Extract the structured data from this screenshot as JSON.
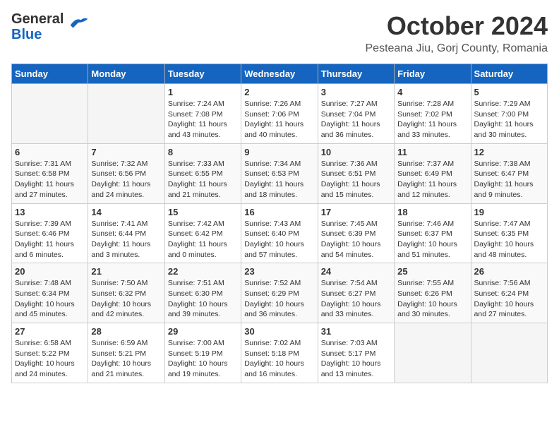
{
  "header": {
    "logo_general": "General",
    "logo_blue": "Blue",
    "month_title": "October 2024",
    "location": "Pesteana Jiu, Gorj County, Romania"
  },
  "days_of_week": [
    "Sunday",
    "Monday",
    "Tuesday",
    "Wednesday",
    "Thursday",
    "Friday",
    "Saturday"
  ],
  "weeks": [
    [
      {
        "day": "",
        "sunrise": "",
        "sunset": "",
        "daylight": ""
      },
      {
        "day": "",
        "sunrise": "",
        "sunset": "",
        "daylight": ""
      },
      {
        "day": "1",
        "sunrise": "Sunrise: 7:24 AM",
        "sunset": "Sunset: 7:08 PM",
        "daylight": "Daylight: 11 hours and 43 minutes."
      },
      {
        "day": "2",
        "sunrise": "Sunrise: 7:26 AM",
        "sunset": "Sunset: 7:06 PM",
        "daylight": "Daylight: 11 hours and 40 minutes."
      },
      {
        "day": "3",
        "sunrise": "Sunrise: 7:27 AM",
        "sunset": "Sunset: 7:04 PM",
        "daylight": "Daylight: 11 hours and 36 minutes."
      },
      {
        "day": "4",
        "sunrise": "Sunrise: 7:28 AM",
        "sunset": "Sunset: 7:02 PM",
        "daylight": "Daylight: 11 hours and 33 minutes."
      },
      {
        "day": "5",
        "sunrise": "Sunrise: 7:29 AM",
        "sunset": "Sunset: 7:00 PM",
        "daylight": "Daylight: 11 hours and 30 minutes."
      }
    ],
    [
      {
        "day": "6",
        "sunrise": "Sunrise: 7:31 AM",
        "sunset": "Sunset: 6:58 PM",
        "daylight": "Daylight: 11 hours and 27 minutes."
      },
      {
        "day": "7",
        "sunrise": "Sunrise: 7:32 AM",
        "sunset": "Sunset: 6:56 PM",
        "daylight": "Daylight: 11 hours and 24 minutes."
      },
      {
        "day": "8",
        "sunrise": "Sunrise: 7:33 AM",
        "sunset": "Sunset: 6:55 PM",
        "daylight": "Daylight: 11 hours and 21 minutes."
      },
      {
        "day": "9",
        "sunrise": "Sunrise: 7:34 AM",
        "sunset": "Sunset: 6:53 PM",
        "daylight": "Daylight: 11 hours and 18 minutes."
      },
      {
        "day": "10",
        "sunrise": "Sunrise: 7:36 AM",
        "sunset": "Sunset: 6:51 PM",
        "daylight": "Daylight: 11 hours and 15 minutes."
      },
      {
        "day": "11",
        "sunrise": "Sunrise: 7:37 AM",
        "sunset": "Sunset: 6:49 PM",
        "daylight": "Daylight: 11 hours and 12 minutes."
      },
      {
        "day": "12",
        "sunrise": "Sunrise: 7:38 AM",
        "sunset": "Sunset: 6:47 PM",
        "daylight": "Daylight: 11 hours and 9 minutes."
      }
    ],
    [
      {
        "day": "13",
        "sunrise": "Sunrise: 7:39 AM",
        "sunset": "Sunset: 6:46 PM",
        "daylight": "Daylight: 11 hours and 6 minutes."
      },
      {
        "day": "14",
        "sunrise": "Sunrise: 7:41 AM",
        "sunset": "Sunset: 6:44 PM",
        "daylight": "Daylight: 11 hours and 3 minutes."
      },
      {
        "day": "15",
        "sunrise": "Sunrise: 7:42 AM",
        "sunset": "Sunset: 6:42 PM",
        "daylight": "Daylight: 11 hours and 0 minutes."
      },
      {
        "day": "16",
        "sunrise": "Sunrise: 7:43 AM",
        "sunset": "Sunset: 6:40 PM",
        "daylight": "Daylight: 10 hours and 57 minutes."
      },
      {
        "day": "17",
        "sunrise": "Sunrise: 7:45 AM",
        "sunset": "Sunset: 6:39 PM",
        "daylight": "Daylight: 10 hours and 54 minutes."
      },
      {
        "day": "18",
        "sunrise": "Sunrise: 7:46 AM",
        "sunset": "Sunset: 6:37 PM",
        "daylight": "Daylight: 10 hours and 51 minutes."
      },
      {
        "day": "19",
        "sunrise": "Sunrise: 7:47 AM",
        "sunset": "Sunset: 6:35 PM",
        "daylight": "Daylight: 10 hours and 48 minutes."
      }
    ],
    [
      {
        "day": "20",
        "sunrise": "Sunrise: 7:48 AM",
        "sunset": "Sunset: 6:34 PM",
        "daylight": "Daylight: 10 hours and 45 minutes."
      },
      {
        "day": "21",
        "sunrise": "Sunrise: 7:50 AM",
        "sunset": "Sunset: 6:32 PM",
        "daylight": "Daylight: 10 hours and 42 minutes."
      },
      {
        "day": "22",
        "sunrise": "Sunrise: 7:51 AM",
        "sunset": "Sunset: 6:30 PM",
        "daylight": "Daylight: 10 hours and 39 minutes."
      },
      {
        "day": "23",
        "sunrise": "Sunrise: 7:52 AM",
        "sunset": "Sunset: 6:29 PM",
        "daylight": "Daylight: 10 hours and 36 minutes."
      },
      {
        "day": "24",
        "sunrise": "Sunrise: 7:54 AM",
        "sunset": "Sunset: 6:27 PM",
        "daylight": "Daylight: 10 hours and 33 minutes."
      },
      {
        "day": "25",
        "sunrise": "Sunrise: 7:55 AM",
        "sunset": "Sunset: 6:26 PM",
        "daylight": "Daylight: 10 hours and 30 minutes."
      },
      {
        "day": "26",
        "sunrise": "Sunrise: 7:56 AM",
        "sunset": "Sunset: 6:24 PM",
        "daylight": "Daylight: 10 hours and 27 minutes."
      }
    ],
    [
      {
        "day": "27",
        "sunrise": "Sunrise: 6:58 AM",
        "sunset": "Sunset: 5:22 PM",
        "daylight": "Daylight: 10 hours and 24 minutes."
      },
      {
        "day": "28",
        "sunrise": "Sunrise: 6:59 AM",
        "sunset": "Sunset: 5:21 PM",
        "daylight": "Daylight: 10 hours and 21 minutes."
      },
      {
        "day": "29",
        "sunrise": "Sunrise: 7:00 AM",
        "sunset": "Sunset: 5:19 PM",
        "daylight": "Daylight: 10 hours and 19 minutes."
      },
      {
        "day": "30",
        "sunrise": "Sunrise: 7:02 AM",
        "sunset": "Sunset: 5:18 PM",
        "daylight": "Daylight: 10 hours and 16 minutes."
      },
      {
        "day": "31",
        "sunrise": "Sunrise: 7:03 AM",
        "sunset": "Sunset: 5:17 PM",
        "daylight": "Daylight: 10 hours and 13 minutes."
      },
      {
        "day": "",
        "sunrise": "",
        "sunset": "",
        "daylight": ""
      },
      {
        "day": "",
        "sunrise": "",
        "sunset": "",
        "daylight": ""
      }
    ]
  ]
}
